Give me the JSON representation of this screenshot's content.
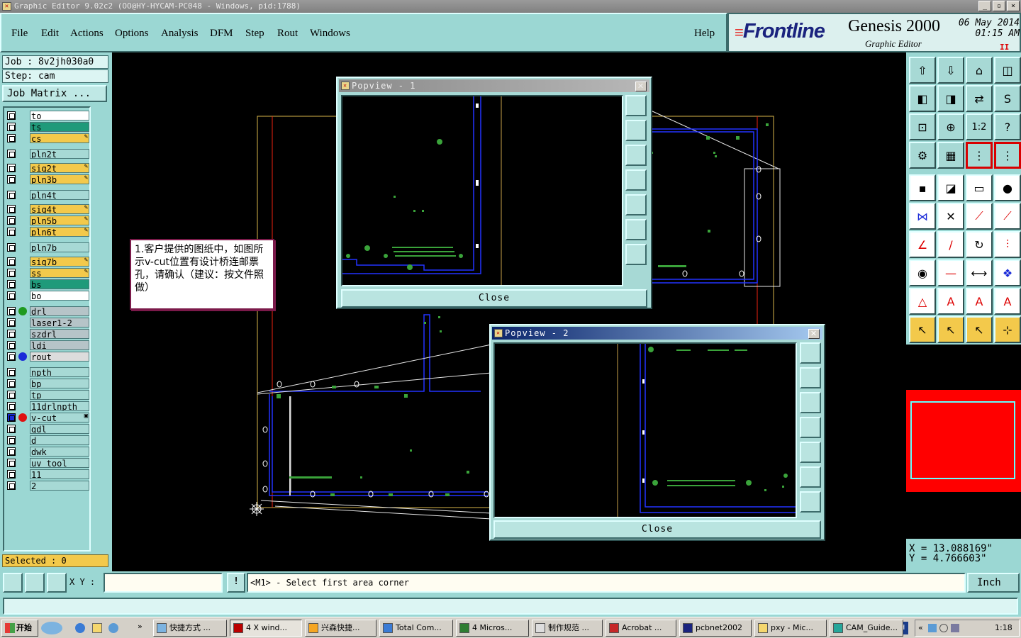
{
  "window": {
    "title": "Graphic Editor 9.02c2 (OO@HY-HYCAM-PC048 - Windows, pid:1788)",
    "controls": [
      "_",
      "▫",
      "×"
    ]
  },
  "menu": [
    "File",
    "Edit",
    "Actions",
    "Options",
    "Analysis",
    "DFM",
    "Step",
    "Rout",
    "Windows"
  ],
  "help": "Help",
  "brand": {
    "logo": "Frontline",
    "product": "Genesis 2000",
    "subtitle": "Graphic Editor",
    "date": "06 May 2014",
    "time": "01:15 AM",
    "pause": "II"
  },
  "job": "Job : 8v2jh030a0",
  "step": "Step: cam",
  "job_matrix": "Job Matrix ...",
  "layers": [
    {
      "name": "to",
      "color": "#ffffff",
      "dot": "",
      "flag": ""
    },
    {
      "name": "ts",
      "color": "#1f9a7a",
      "dot": "",
      "flag": ""
    },
    {
      "name": "cs",
      "color": "#f3c94b",
      "dot": "",
      "flag": "✎"
    },
    {
      "name": "pln2t",
      "color": "#a7d9d5",
      "dot": "",
      "flag": ""
    },
    {
      "name": "sig2t",
      "color": "#f3c94b",
      "dot": "",
      "flag": "✎"
    },
    {
      "name": "pln3b",
      "color": "#f3c94b",
      "dot": "",
      "flag": "✎"
    },
    {
      "name": "pln4t",
      "color": "#a7d9d5",
      "dot": "",
      "flag": ""
    },
    {
      "name": "sig4t",
      "color": "#f3c94b",
      "dot": "",
      "flag": "✎"
    },
    {
      "name": "pln5b",
      "color": "#f3c94b",
      "dot": "",
      "flag": "✎"
    },
    {
      "name": "pln6t",
      "color": "#f3c94b",
      "dot": "",
      "flag": "✎"
    },
    {
      "name": "pln7b",
      "color": "#a7d9d5",
      "dot": "",
      "flag": ""
    },
    {
      "name": "sig7b",
      "color": "#f3c94b",
      "dot": "",
      "flag": "✎"
    },
    {
      "name": "ss",
      "color": "#f3c94b",
      "dot": "",
      "flag": "✎"
    },
    {
      "name": "bs",
      "color": "#1f9a7a",
      "dot": "",
      "flag": ""
    },
    {
      "name": "bo",
      "color": "#ffffff",
      "dot": "",
      "flag": ""
    },
    {
      "name": "drl",
      "color": "#b6c4c8",
      "dot": "#1f9a1f",
      "flag": ""
    },
    {
      "name": "laser1-2",
      "color": "#b6c4c8",
      "dot": "",
      "flag": ""
    },
    {
      "name": "szdrl",
      "color": "#b6c4c8",
      "dot": "",
      "flag": ""
    },
    {
      "name": "ldi",
      "color": "#b6c4c8",
      "dot": "",
      "flag": ""
    },
    {
      "name": "rout",
      "color": "#dcdcdc",
      "dot": "#1a2bd8",
      "flag": ""
    },
    {
      "name": "npth",
      "color": "#a7d9d5",
      "dot": "",
      "flag": ""
    },
    {
      "name": "bp",
      "color": "#a7d9d5",
      "dot": "",
      "flag": ""
    },
    {
      "name": "tp",
      "color": "#a7d9d5",
      "dot": "",
      "flag": ""
    },
    {
      "name": "11drlnpth",
      "color": "#a7d9d5",
      "dot": "",
      "flag": ""
    },
    {
      "name": "v-cut",
      "color": "#a7d9d5",
      "dot": "#e01010",
      "flag": "▣"
    },
    {
      "name": "gdl",
      "color": "#a7d9d5",
      "dot": "",
      "flag": ""
    },
    {
      "name": "d",
      "color": "#a7d9d5",
      "dot": "",
      "flag": ""
    },
    {
      "name": "dwk",
      "color": "#a7d9d5",
      "dot": "",
      "flag": ""
    },
    {
      "name": "uv_tool",
      "color": "#a7d9d5",
      "dot": "",
      "flag": ""
    },
    {
      "name": "11",
      "color": "#a7d9d5",
      "dot": "",
      "flag": ""
    },
    {
      "name": "2",
      "color": "#a7d9d5",
      "dot": "",
      "flag": ""
    }
  ],
  "selected": "Selected : 0",
  "note": "1.客户提供的图纸中，如图所示v-cut位置有设计桥连邮票孔，请确认（建议：按文件照做）",
  "popview1": {
    "title": "Popview - 1",
    "close": "Close"
  },
  "popview2": {
    "title": "Popview - 2",
    "close": "Close"
  },
  "tools": [
    "put-icon",
    "get-icon",
    "home-icon",
    "split-view-icon",
    "pan-left-icon",
    "pan-right-icon",
    "swap-icon",
    "flip-icon",
    "zoom-fit-icon",
    "zoom-center-icon",
    "zoom-1to2-icon",
    "query-icon",
    "settings-icon",
    "grid-icon",
    "layer-red-icon",
    "layer-red-icon-2",
    "add-feature-icon",
    "outline-icon",
    "ruler-icon",
    "dot-icon",
    "connect-icon",
    "cross-icon",
    "line-add-icon",
    "line-edit-icon",
    "angle-icon",
    "slash-icon",
    "arc-icon",
    "align-icon",
    "pad-icon",
    "dash-icon",
    "measure-icon",
    "shapes-icon",
    "triangle-icon",
    "triangle-a-icon",
    "triangle-a2-icon",
    "triangle-a3-icon",
    "select-icon",
    "select-box-icon",
    "select-snap-icon",
    "select-net-icon"
  ],
  "tool_labels": {
    "zoom12": "1:2",
    "query": "?"
  },
  "coords": {
    "x": "X = 13.088169\"",
    "y": "Y = 4.766603\""
  },
  "xy_label": "X Y :",
  "xy_value": "",
  "warn": "!",
  "prompt": "<M1> - Select first area corner",
  "unit": "Inch",
  "taskbar": {
    "start": "开始",
    "items": [
      "快捷方式 ...",
      "4 X wind...",
      "兴森快捷...",
      "Total Com...",
      "4 Micros...",
      "制作规范 ...",
      "Acrobat ...",
      "pcbnet2002",
      "pxy - Mic...",
      "CAM_Guide..."
    ],
    "lang": "CH",
    "clock": "1:18"
  }
}
